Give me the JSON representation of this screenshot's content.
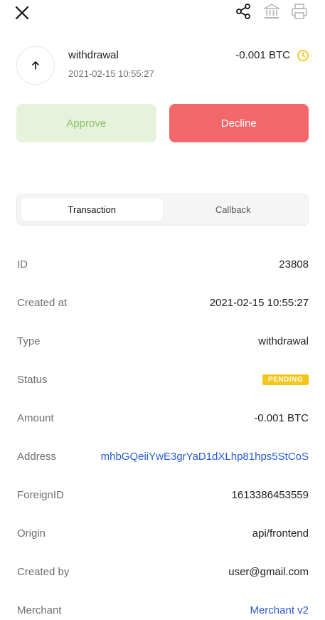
{
  "header": {
    "close_icon": "close-icon",
    "share_icon": "share-icon",
    "bank_icon": "bank-icon",
    "print_icon": "printer-icon"
  },
  "summary": {
    "direction_icon": "arrow-up-icon",
    "type": "withdrawal",
    "datetime": "2021-02-15 10:55:27",
    "amount": "-0.001 BTC",
    "status_icon": "clock-icon"
  },
  "actions": {
    "approve_label": "Approve",
    "decline_label": "Decline"
  },
  "tabs": [
    {
      "label": "Transaction",
      "active": true
    },
    {
      "label": "Callback",
      "active": false
    }
  ],
  "details": [
    {
      "label": "ID",
      "value": "23808"
    },
    {
      "label": "Created at",
      "value": "2021-02-15 10:55:27"
    },
    {
      "label": "Type",
      "value": "withdrawal"
    },
    {
      "label": "Status",
      "value": "PENDING"
    },
    {
      "label": "Amount",
      "value": "-0.001 BTC"
    },
    {
      "label": "Address",
      "value": "mhbGQeiiYwE3grYaD1dXLhp81hps5StCoS"
    },
    {
      "label": "ForeignID",
      "value": "1613386453559"
    },
    {
      "label": "Origin",
      "value": "api/frontend"
    },
    {
      "label": "Created by",
      "value": "user@gmail.com"
    },
    {
      "label": "Merchant",
      "value": "Merchant v2"
    }
  ],
  "colors": {
    "approve_bg": "#e6f2dc",
    "approve_text": "#8bc166",
    "decline_bg": "#f2676a",
    "link": "#2a5bd7",
    "pending_badge": "#f5c518",
    "clock": "#f5c518"
  }
}
